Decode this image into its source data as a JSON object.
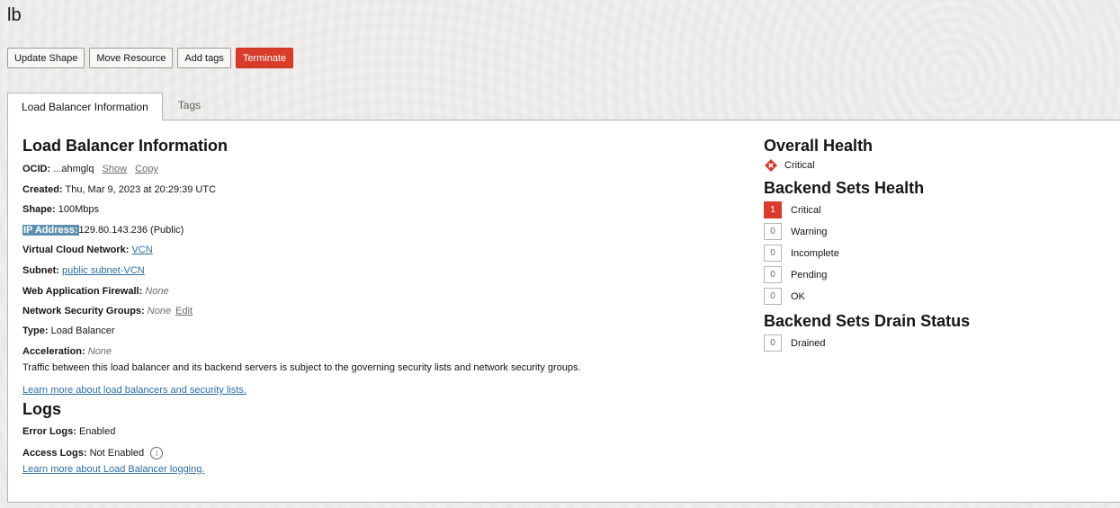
{
  "page": {
    "title": "lb"
  },
  "actions": {
    "update_shape": "Update Shape",
    "move_resource": "Move Resource",
    "add_tags": "Add tags",
    "terminate": "Terminate"
  },
  "tabs": {
    "info": "Load Balancer Information",
    "tags": "Tags"
  },
  "info": {
    "heading": "Load Balancer Information",
    "ocid_label": "OCID:",
    "ocid_value": "...ahmglq",
    "show": "Show",
    "copy": "Copy",
    "created_label": "Created:",
    "created_value": "Thu, Mar 9, 2023 at 20:29:39 UTC",
    "shape_label": "Shape:",
    "shape_value": "100Mbps",
    "ip_label": "IP Address:",
    "ip_value": "129.80.143.236 (Public)",
    "vcn_label": "Virtual Cloud Network:",
    "vcn_value": "VCN",
    "subnet_label": "Subnet:",
    "subnet_value": "public subnet-VCN",
    "waf_label": "Web Application Firewall:",
    "waf_value": "None",
    "nsg_label": "Network Security Groups:",
    "nsg_value": "None",
    "nsg_edit": "Edit",
    "type_label": "Type:",
    "type_value": "Load Balancer",
    "accel_label": "Acceleration:",
    "accel_value": "None",
    "traffic_note": "Traffic between this load balancer and its backend servers is subject to the governing security lists and network security groups.",
    "learn_security": "Learn more about load balancers and security lists."
  },
  "logs": {
    "heading": "Logs",
    "error_label": "Error Logs:",
    "error_value": "Enabled",
    "access_label": "Access Logs:",
    "access_value": "Not Enabled",
    "info_icon": "i",
    "learn_logging": "Learn more about Load Balancer logging."
  },
  "health": {
    "overall_heading": "Overall Health",
    "overall_status": "Critical",
    "overall_icon": "critical-diamond-icon",
    "backend_heading": "Backend Sets Health",
    "backend": [
      {
        "count": "1",
        "label": "Critical"
      },
      {
        "count": "0",
        "label": "Warning"
      },
      {
        "count": "0",
        "label": "Incomplete"
      },
      {
        "count": "0",
        "label": "Pending"
      },
      {
        "count": "0",
        "label": "OK"
      }
    ],
    "drain_heading": "Backend Sets Drain Status",
    "drain": {
      "count": "0",
      "label": "Drained"
    }
  },
  "colors": {
    "danger": "#d93c2b",
    "link": "#2c6da6",
    "highlight": "#5f8fb0"
  }
}
